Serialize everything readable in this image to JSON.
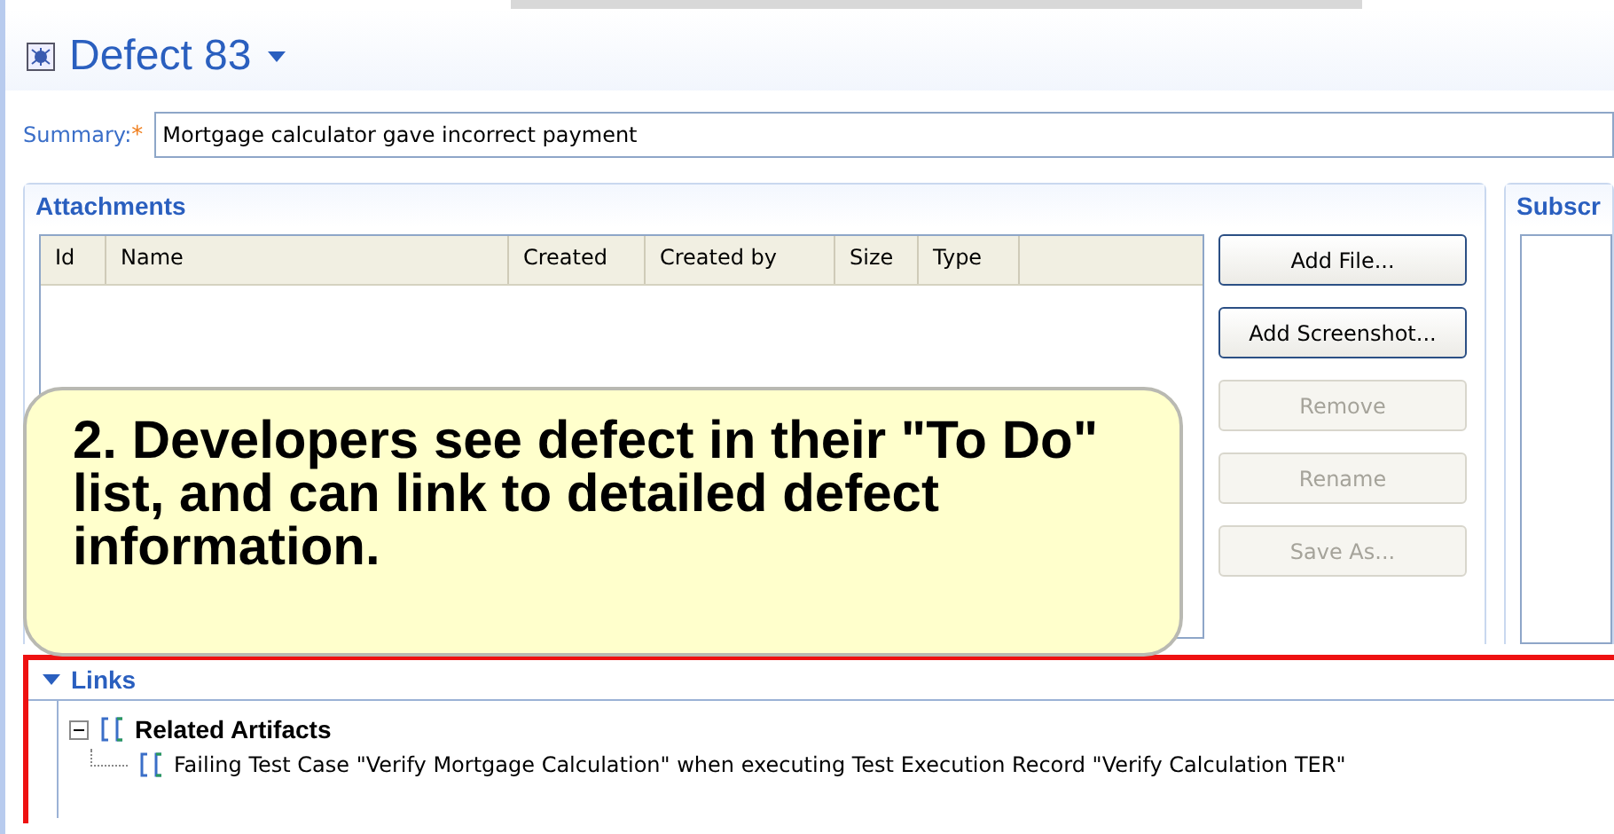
{
  "title": "Defect 83",
  "summary": {
    "label": "Summary:",
    "required_mark": "*",
    "value": "Mortgage calculator gave incorrect payment"
  },
  "attachments": {
    "title": "Attachments",
    "columns": [
      "Id",
      "Name",
      "Created",
      "Created by",
      "Size",
      "Type"
    ],
    "buttons": [
      {
        "label": "Add File...",
        "disabled": false
      },
      {
        "label": "Add Screenshot...",
        "disabled": false
      },
      {
        "label": "Remove",
        "disabled": true
      },
      {
        "label": "Rename",
        "disabled": true
      },
      {
        "label": "Save As...",
        "disabled": true
      }
    ]
  },
  "subscribers": {
    "title": "Subscr"
  },
  "callout": "2. Developers see defect in their \"To Do\" list, and can link to detailed defect information.",
  "links": {
    "title": "Links",
    "expanded": true,
    "tree": [
      {
        "label": "Related Artifacts",
        "expanded": true,
        "children": [
          {
            "label": "Failing Test Case \"Verify Mortgage Calculation\" when executing Test Execution Record \"Verify Calculation TER\""
          }
        ]
      }
    ]
  }
}
